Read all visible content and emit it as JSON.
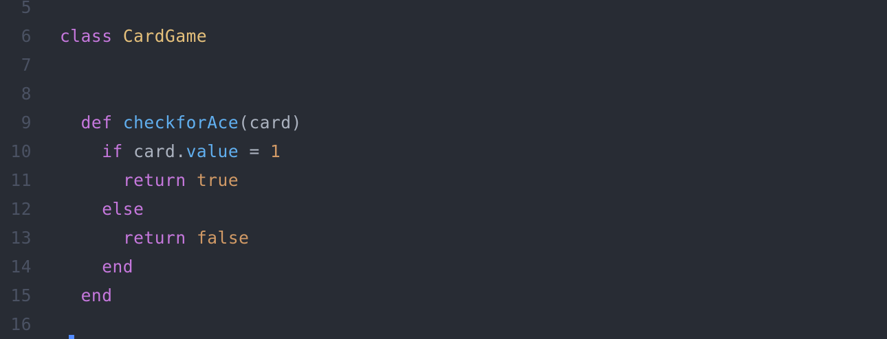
{
  "editor": {
    "lines": [
      {
        "num": "5",
        "tokens": []
      },
      {
        "num": "6",
        "tokens": [
          {
            "text": "class",
            "kind": "keyword"
          },
          {
            "text": " ",
            "kind": "plain"
          },
          {
            "text": "CardGame",
            "kind": "class-name"
          }
        ]
      },
      {
        "num": "7",
        "tokens": []
      },
      {
        "num": "8",
        "tokens": []
      },
      {
        "num": "9",
        "tokens": [
          {
            "text": "  ",
            "kind": "plain"
          },
          {
            "text": "def",
            "kind": "keyword"
          },
          {
            "text": " ",
            "kind": "plain"
          },
          {
            "text": "checkforAce",
            "kind": "function"
          },
          {
            "text": "(card)",
            "kind": "plain"
          }
        ]
      },
      {
        "num": "10",
        "tokens": [
          {
            "text": "    ",
            "kind": "plain"
          },
          {
            "text": "if",
            "kind": "keyword"
          },
          {
            "text": " card.",
            "kind": "plain"
          },
          {
            "text": "value",
            "kind": "function"
          },
          {
            "text": " = ",
            "kind": "plain"
          },
          {
            "text": "1",
            "kind": "number"
          }
        ]
      },
      {
        "num": "11",
        "tokens": [
          {
            "text": "      ",
            "kind": "plain"
          },
          {
            "text": "return",
            "kind": "keyword"
          },
          {
            "text": " ",
            "kind": "plain"
          },
          {
            "text": "true",
            "kind": "number"
          }
        ]
      },
      {
        "num": "12",
        "tokens": [
          {
            "text": "    ",
            "kind": "plain"
          },
          {
            "text": "else",
            "kind": "keyword"
          }
        ]
      },
      {
        "num": "13",
        "tokens": [
          {
            "text": "      ",
            "kind": "plain"
          },
          {
            "text": "return",
            "kind": "keyword"
          },
          {
            "text": " ",
            "kind": "plain"
          },
          {
            "text": "false",
            "kind": "number"
          }
        ]
      },
      {
        "num": "14",
        "tokens": [
          {
            "text": "    ",
            "kind": "plain"
          },
          {
            "text": "end",
            "kind": "keyword"
          }
        ]
      },
      {
        "num": "15",
        "tokens": [
          {
            "text": "  ",
            "kind": "plain"
          },
          {
            "text": "end",
            "kind": "keyword"
          }
        ]
      },
      {
        "num": "16",
        "tokens": []
      }
    ]
  },
  "colors": {
    "background": "#282c34",
    "gutter": "#4b5263",
    "keyword": "#c678dd",
    "class_name": "#e5c07b",
    "function": "#61afef",
    "number": "#d19a66",
    "plain": "#abb2bf",
    "cursor": "#528bff"
  }
}
